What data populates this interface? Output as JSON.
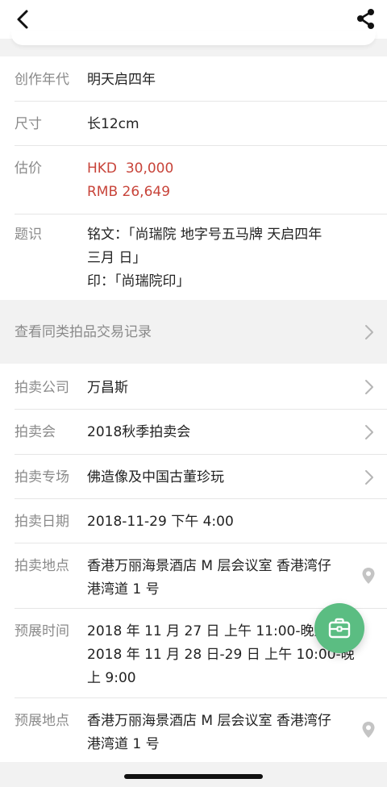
{
  "header": {
    "back_icon": "chevron-left-icon",
    "share_icon": "share-icon"
  },
  "details": {
    "era_label": "创作年代",
    "era_value": "明天启四年",
    "size_label": "尺寸",
    "size_value": "长12cm",
    "estimate_label": "估价",
    "estimate_hkd": "HKD  30,000",
    "estimate_rmb": "RMB 26,649",
    "inscription_label": "题识",
    "inscription_line1": "铭文：「尚瑞院 地字号五马牌 天启四年",
    "inscription_line2": "三月 日」",
    "inscription_line3": "印：「尚瑞院印」"
  },
  "similar_records": {
    "label": "查看同类拍品交易记录"
  },
  "auction": {
    "company_label": "拍卖公司",
    "company_value": "万昌斯",
    "sale_label": "拍卖会",
    "sale_value": "2018秋季拍卖会",
    "session_label": "拍卖专场",
    "session_value": "佛造像及中国古董珍玩",
    "date_label": "拍卖日期",
    "date_value": "2018-11-29 下午 4:00",
    "venue_label": "拍卖地点",
    "venue_line1": "香港万丽海景酒店 M 层会议室 香港湾仔",
    "venue_line2": "港湾道 1 号",
    "preview_time_label": "预展时间",
    "preview_time_line1": "2018 年 11 月 27 日  上午 11:00-晚上 9",
    "preview_time_line2": "2018 年 11 月 28 日-29 日  上午 10:00-晚",
    "preview_time_line3": "上 9:00",
    "preview_venue_label": "预展地点",
    "preview_venue_line1": "香港万丽海景酒店 M 层会议室 香港湾仔",
    "preview_venue_line2": "港湾道 1 号"
  },
  "colors": {
    "accent_green": "#5bbd82",
    "price_red": "#c8443a"
  }
}
